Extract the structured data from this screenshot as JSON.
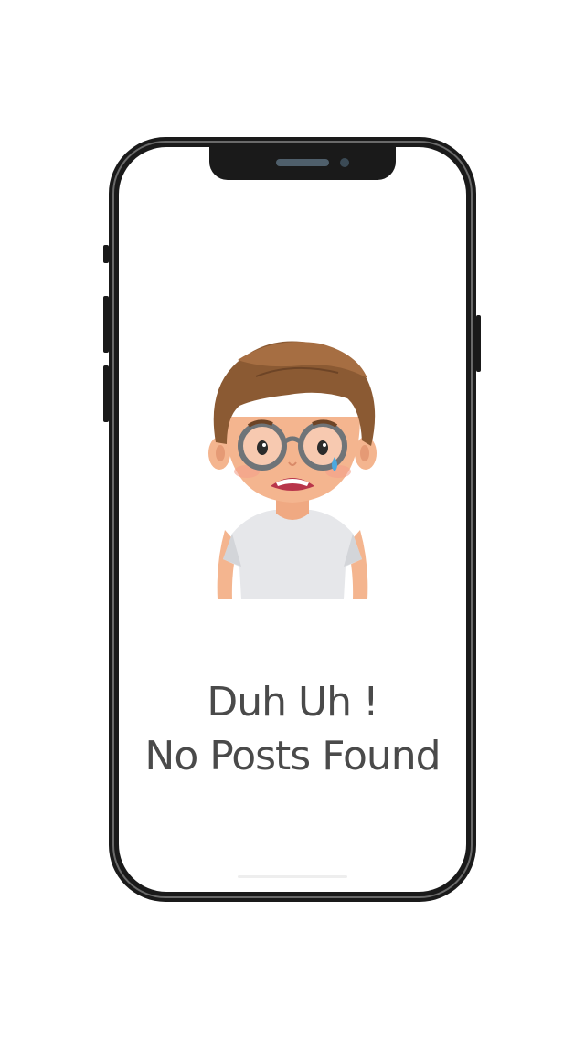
{
  "empty_state": {
    "line1": "Duh Uh !",
    "line2": "No Posts Found",
    "illustration": "crying-boy-with-glasses"
  },
  "colors": {
    "text": "#4a4a4a",
    "phone_frame": "#1a1a1a",
    "screen_background": "#ffffff"
  }
}
